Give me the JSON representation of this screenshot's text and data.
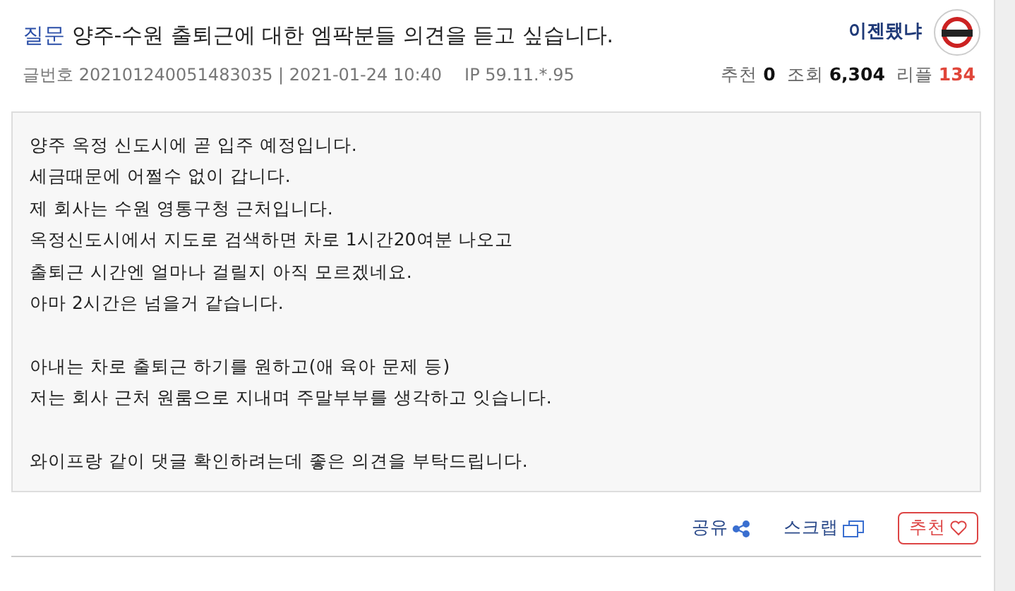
{
  "post": {
    "category": "질문",
    "title": "양주-수원 출퇴근에 대한 엠팍분들 의견을 듣고 싶습니다.",
    "author": "이젠됐냐",
    "meta": {
      "number_label": "글번호",
      "number": "202101240051483035 | 2021-01-24 10:40",
      "ip_label": "IP",
      "ip": "59.11.*.95"
    },
    "stats": [
      {
        "label": "추천",
        "value": "0",
        "kind": "plain"
      },
      {
        "label": "조회",
        "value": "6,304",
        "kind": "plain"
      },
      {
        "label": "리플",
        "value": "134",
        "kind": "accent"
      }
    ]
  },
  "body": {
    "paragraphs": [
      [
        "양주 옥정 신도시에 곧 입주 예정입니다.",
        "세금때문에 어쩔수 없이 갑니다.",
        "제 회사는 수원 영통구청 근처입니다.",
        "옥정신도시에서 지도로 검색하면 차로 1시간20여분 나오고",
        "출퇴근 시간엔 얼마나 걸릴지 아직 모르겠네요.",
        "아마 2시간은 넘을거 같습니다."
      ],
      [
        "아내는 차로 출퇴근 하기를 원하고(애 육아 문제 등)",
        "저는 회사 근처 원룸으로 지내며 주말부부를 생각하고 잇습니다."
      ],
      [
        "와이프랑 같이 댓글 확인하려는데 좋은 의견을 부탁드립니다."
      ]
    ]
  },
  "actions": [
    {
      "label": "공유",
      "kind": "share"
    },
    {
      "label": "스크랩",
      "kind": "scrap"
    },
    {
      "label": "추천",
      "kind": "recommend"
    }
  ]
}
